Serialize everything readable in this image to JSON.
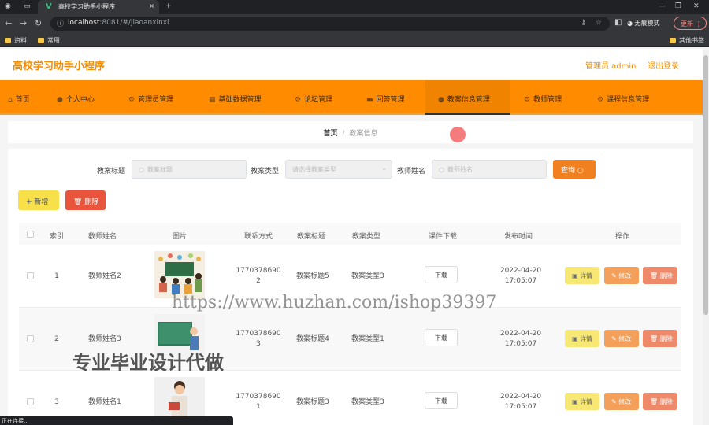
{
  "browser": {
    "tab_title": "高校学习助手小程序",
    "tab_close": "×",
    "new_tab": "+",
    "url_host": "localhost",
    "url_path": ":8081/#/jiaoanxinxi",
    "incognito": "无痕模式",
    "update": "更新 ⋮",
    "bookmarks": [
      "资料",
      "常用"
    ],
    "other_bookmarks": "其他书签",
    "status": "正在连接..."
  },
  "header": {
    "title": "高校学习助手小程序",
    "admin": "管理员 admin",
    "logout": "退出登录"
  },
  "menu": [
    {
      "icon": "home-icon",
      "glyph": "⌂",
      "label": "首页"
    },
    {
      "icon": "user-icon",
      "glyph": "●",
      "label": "个人中心"
    },
    {
      "icon": "gear-icon",
      "glyph": "⚙",
      "label": "管理员管理"
    },
    {
      "icon": "grid-icon",
      "glyph": "▦",
      "label": "基础数据管理"
    },
    {
      "icon": "gear-icon",
      "glyph": "⚙",
      "label": "论坛管理"
    },
    {
      "icon": "chat-icon",
      "glyph": "▬",
      "label": "回答管理"
    },
    {
      "icon": "user-icon",
      "glyph": "●",
      "label": "教案信息管理"
    },
    {
      "icon": "gear-icon",
      "glyph": "⚙",
      "label": "教师管理"
    },
    {
      "icon": "gear-icon",
      "glyph": "⚙",
      "label": "课程信息管理"
    }
  ],
  "breadcrumb": {
    "home": "首页",
    "sep": "/",
    "current": "教案信息"
  },
  "search": {
    "title_label": "教案标题",
    "title_placeholder": "教案标题",
    "type_label": "教案类型",
    "type_placeholder": "请选择教案类型",
    "teacher_label": "教师姓名",
    "teacher_placeholder": "教师姓名",
    "query": "查询"
  },
  "actions": {
    "add": "新增",
    "delete": "删除"
  },
  "table": {
    "headers": [
      "索引",
      "教师姓名",
      "图片",
      "联系方式",
      "教案标题",
      "教案类型",
      "课件下载",
      "发布时间",
      "操作"
    ],
    "rows": [
      {
        "index": "1",
        "teacher": "教师姓名2",
        "phone1": "1770378690",
        "phone2": "2",
        "title": "教案标题5",
        "type": "教案类型3",
        "download": "下载",
        "date": "2022-04-20",
        "time": "17:05:07"
      },
      {
        "index": "2",
        "teacher": "教师姓名3",
        "phone1": "1770378690",
        "phone2": "3",
        "title": "教案标题4",
        "type": "教案类型1",
        "download": "下载",
        "date": "2022-04-20",
        "time": "17:05:07"
      },
      {
        "index": "3",
        "teacher": "教师姓名1",
        "phone1": "1770378690",
        "phone2": "1",
        "title": "教案标题3",
        "type": "教案类型3",
        "download": "下载",
        "date": "2022-04-20",
        "time": "17:05:07"
      }
    ],
    "row_buttons": {
      "detail": "详情",
      "edit": "修改",
      "remove": "删除"
    }
  },
  "overlay": {
    "watermark": "https://www.huzhan.com/ishop39397",
    "ad": "专业毕业设计代做"
  },
  "colors": {
    "accent": "#ff8c00",
    "title": "#f08c00"
  }
}
